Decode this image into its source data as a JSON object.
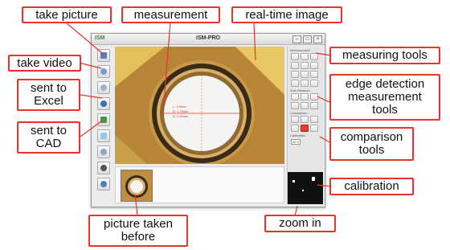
{
  "app": {
    "logo": "ISM",
    "title": "ISM-PRO",
    "window_buttons": [
      "–",
      "□",
      "×"
    ],
    "panel_labels": {
      "measurement": "Measurement",
      "edge_detection": "Auto Measure",
      "comparison": "Comparison",
      "calibration": "Calibration"
    },
    "calibration_value": "40 X",
    "readout": [
      "L: 2.0mm",
      "D: 1.70mm",
      "A: 1.30mm"
    ]
  },
  "callouts": {
    "take_picture": "take picture",
    "measurement": "measurement",
    "real_time_image": "real-time image",
    "take_video": "take video",
    "measuring_tools": "measuring tools",
    "sent_to_excel": [
      "sent to",
      "Excel"
    ],
    "edge_detection": [
      "edge detection",
      "measurement",
      "tools"
    ],
    "sent_to_cad": [
      "sent to",
      "CAD"
    ],
    "comparison_tools": [
      "comparison",
      "tools"
    ],
    "calibration": "calibration",
    "picture_taken_before": [
      "picture taken",
      "before"
    ],
    "zoom_in": "zoom in"
  },
  "colors": {
    "callout_border": "#e8332a",
    "image_brown": "#bb8a3c",
    "ring_dark": "#3a2a18",
    "disc_light": "#f4f4f2"
  },
  "icons": {
    "take_picture": "camera-icon",
    "take_video": "video-icon",
    "sent_to_excel": "excel-icon",
    "sent_to_cad": "cad-icon"
  }
}
